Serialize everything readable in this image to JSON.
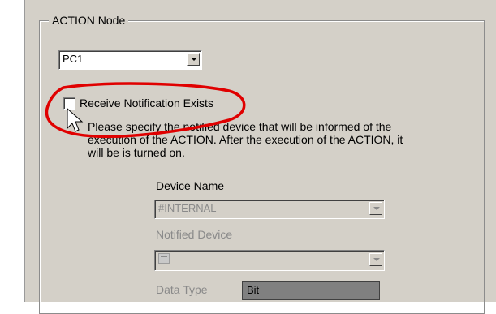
{
  "group": {
    "title": "ACTION Node"
  },
  "node_select": {
    "value": "PC1"
  },
  "receive_checkbox": {
    "label": "Receive Notification Exists",
    "checked": false
  },
  "description": "Please specify the notified device that will be informed of the execution of the ACTION. After the execution of the ACTION, it will be is turned on.",
  "device_name": {
    "label": "Device Name",
    "value": "#INTERNAL"
  },
  "notified_device": {
    "label": "Notified Device",
    "value": ""
  },
  "data_type": {
    "label": "Data Type",
    "value": "Bit"
  },
  "colors": {
    "panel_bg": "#d4d0c8",
    "highlight": "#e00000"
  },
  "icons": [
    "chevron-down-icon",
    "device-icon",
    "mouse-cursor-icon"
  ]
}
